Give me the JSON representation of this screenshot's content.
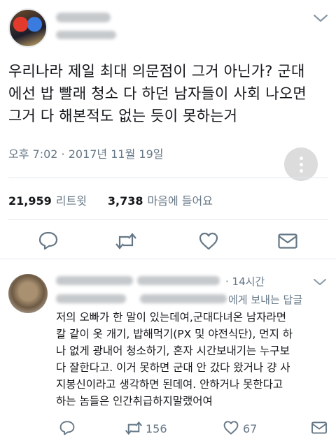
{
  "tweet": {
    "text": "우리나라 제일 최대 의문점이 그거 아닌가? 군대\n에선 밥 빨래 청소 다 하던 남자들이 사회 나오면\n그거 다 해본적도 없는 듯이 못하는거",
    "timestamp": "오후 7:02 · 2017년 11월 19일",
    "retweets_count": "21,959",
    "retweets_label": "리트윗",
    "likes_count": "3,738",
    "likes_label": "마음에 들어요"
  },
  "reply": {
    "time": "· 14시간",
    "reply_to_suffix": "에게 보내는 답글",
    "text": "저의 오빠가 한 말이 있는데여,군대다녀온 남자라면\n칼 같이 옷 개기, 밥해먹기(PX 및 야전식단), 먼지 하\n나 없게 광내어 청소하기, 혼자 시간보내기는 누구보\n다 잘한다고. 이거 못하면 군대 안 갔다 왔거나 걍 사\n지봉신이라고 생각하면 된데여. 안하거나 못한다고\n하는 놈들은 인간취급하지말랬어여",
    "retweet_count": "156",
    "like_count": "67"
  },
  "icons": {
    "reply": "reply-icon",
    "retweet": "retweet-icon",
    "like": "heart-icon",
    "dm": "envelope-icon",
    "more": "more-vertical-icon",
    "dropdown": "chevron-down-icon"
  },
  "colors": {
    "text": "#14171a",
    "secondary": "#657786",
    "divider": "#e1e8ed"
  }
}
